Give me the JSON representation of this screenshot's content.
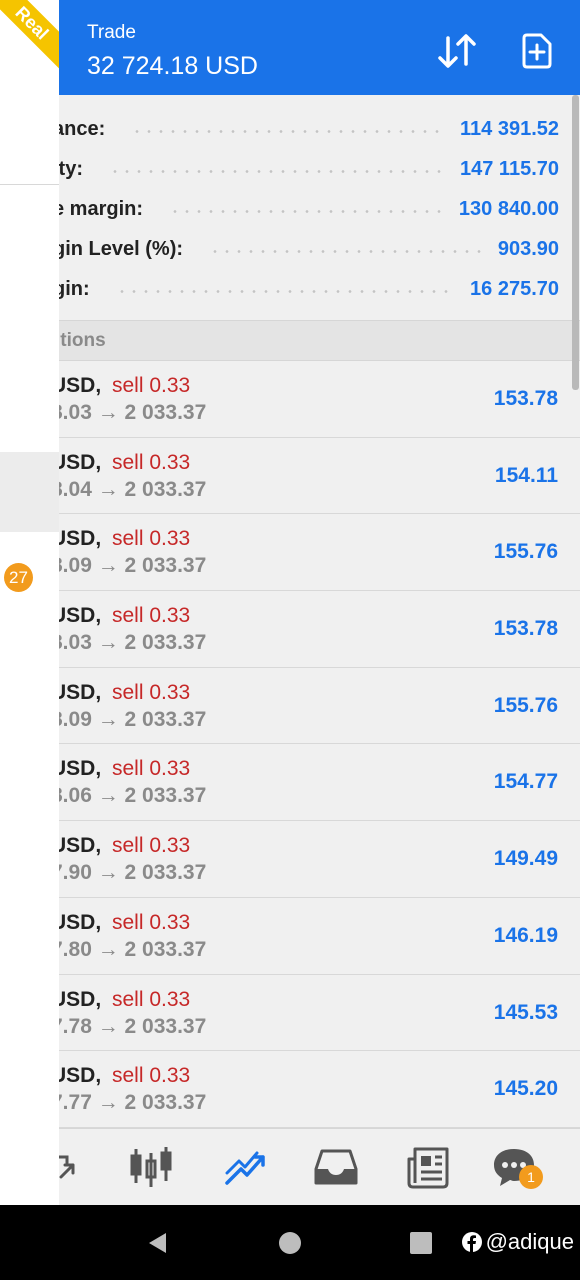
{
  "drawer": {
    "ribbon": "Real",
    "badge": "27"
  },
  "header": {
    "title": "Trade",
    "amount": "32 724.18 USD"
  },
  "summary": [
    {
      "label": "ance:",
      "value": "114 391.52"
    },
    {
      "label": "ity:",
      "value": "147 115.70"
    },
    {
      "label": "e margin:",
      "value": "130 840.00"
    },
    {
      "label": "gin Level (%):",
      "value": "903.90"
    },
    {
      "label": "gin:",
      "value": "16 275.70"
    }
  ],
  "positions_header": "itions",
  "positions": [
    {
      "symbol": "USD,",
      "side": "sell 0.33",
      "prices": "8.03 → 2 033.37",
      "profit": "153.78"
    },
    {
      "symbol": "USD,",
      "side": "sell 0.33",
      "prices": "8.04 → 2 033.37",
      "profit": "154.11"
    },
    {
      "symbol": "USD,",
      "side": "sell 0.33",
      "prices": "8.09 → 2 033.37",
      "profit": "155.76"
    },
    {
      "symbol": "USD,",
      "side": "sell 0.33",
      "prices": "8.03 → 2 033.37",
      "profit": "153.78"
    },
    {
      "symbol": "USD,",
      "side": "sell 0.33",
      "prices": "8.09 → 2 033.37",
      "profit": "155.76"
    },
    {
      "symbol": "USD,",
      "side": "sell 0.33",
      "prices": "8.06 → 2 033.37",
      "profit": "154.77"
    },
    {
      "symbol": "USD,",
      "side": "sell 0.33",
      "prices": "7.90 → 2 033.37",
      "profit": "149.49"
    },
    {
      "symbol": "USD,",
      "side": "sell 0.33",
      "prices": "7.80 → 2 033.37",
      "profit": "146.19"
    },
    {
      "symbol": "USD,",
      "side": "sell 0.33",
      "prices": "7.78 → 2 033.37",
      "profit": "145.53"
    },
    {
      "symbol": "USD,",
      "side": "sell 0.33",
      "prices": "7.77 → 2 033.37",
      "profit": "145.20"
    }
  ],
  "bottom_nav": {
    "items": [
      "quotes-icon",
      "chart-icon",
      "trade-icon",
      "history-icon",
      "news-icon",
      "chat-icon"
    ],
    "active": "trade-icon",
    "chat_badge": "1"
  },
  "watermark": "@adique",
  "colors": {
    "accent": "#1a73e8",
    "sell": "#c62828",
    "badge": "#f29b1d",
    "ribbon": "#f5c400"
  }
}
